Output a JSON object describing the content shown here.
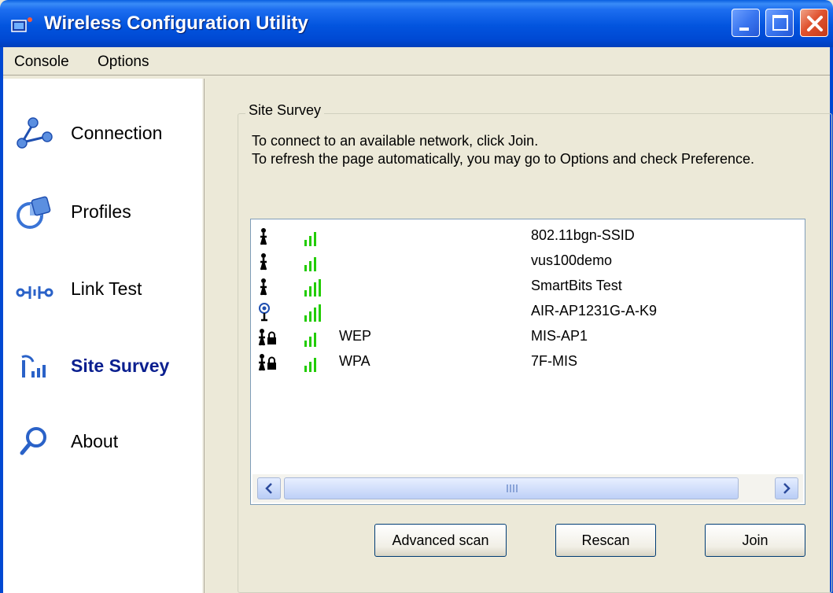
{
  "window": {
    "title": "Wireless Configuration Utility"
  },
  "menu": {
    "console": "Console",
    "options": "Options"
  },
  "sidebar": {
    "items": [
      {
        "label": "Connection",
        "icon": "connection-icon"
      },
      {
        "label": "Profiles",
        "icon": "profiles-icon"
      },
      {
        "label": "Link Test",
        "icon": "link-test-icon"
      },
      {
        "label": "Site Survey",
        "icon": "site-survey-icon",
        "active": true
      },
      {
        "label": "About",
        "icon": "about-icon"
      }
    ]
  },
  "site_survey": {
    "group_title": "Site Survey",
    "instructions_line1": "To connect to an available network, click Join.",
    "instructions_line2": "To refresh the page automatically, you may go to Options and check Preference.",
    "networks": [
      {
        "type_icon": "adhoc-station-icon",
        "signal_bars": 3,
        "security": "",
        "ssid": "802.11bgn-SSID"
      },
      {
        "type_icon": "adhoc-station-icon",
        "signal_bars": 3,
        "security": "",
        "ssid": "vus100demo"
      },
      {
        "type_icon": "adhoc-station-icon",
        "signal_bars": 4,
        "security": "",
        "ssid": "SmartBits Test"
      },
      {
        "type_icon": "access-point-icon",
        "signal_bars": 4,
        "security": "",
        "ssid": "AIR-AP1231G-A-K9"
      },
      {
        "type_icon": "secured-station-icon",
        "signal_bars": 3,
        "security": "WEP",
        "ssid": "MIS-AP1"
      },
      {
        "type_icon": "secured-station-icon",
        "signal_bars": 3,
        "security": "WPA",
        "ssid": "7F-MIS"
      }
    ],
    "buttons": {
      "advanced_scan": "Advanced scan",
      "rescan": "Rescan",
      "join": "Join"
    }
  },
  "colors": {
    "titlebar": "#0054e3",
    "signal": "#22cc00",
    "active_nav": "#0a1f8f"
  }
}
